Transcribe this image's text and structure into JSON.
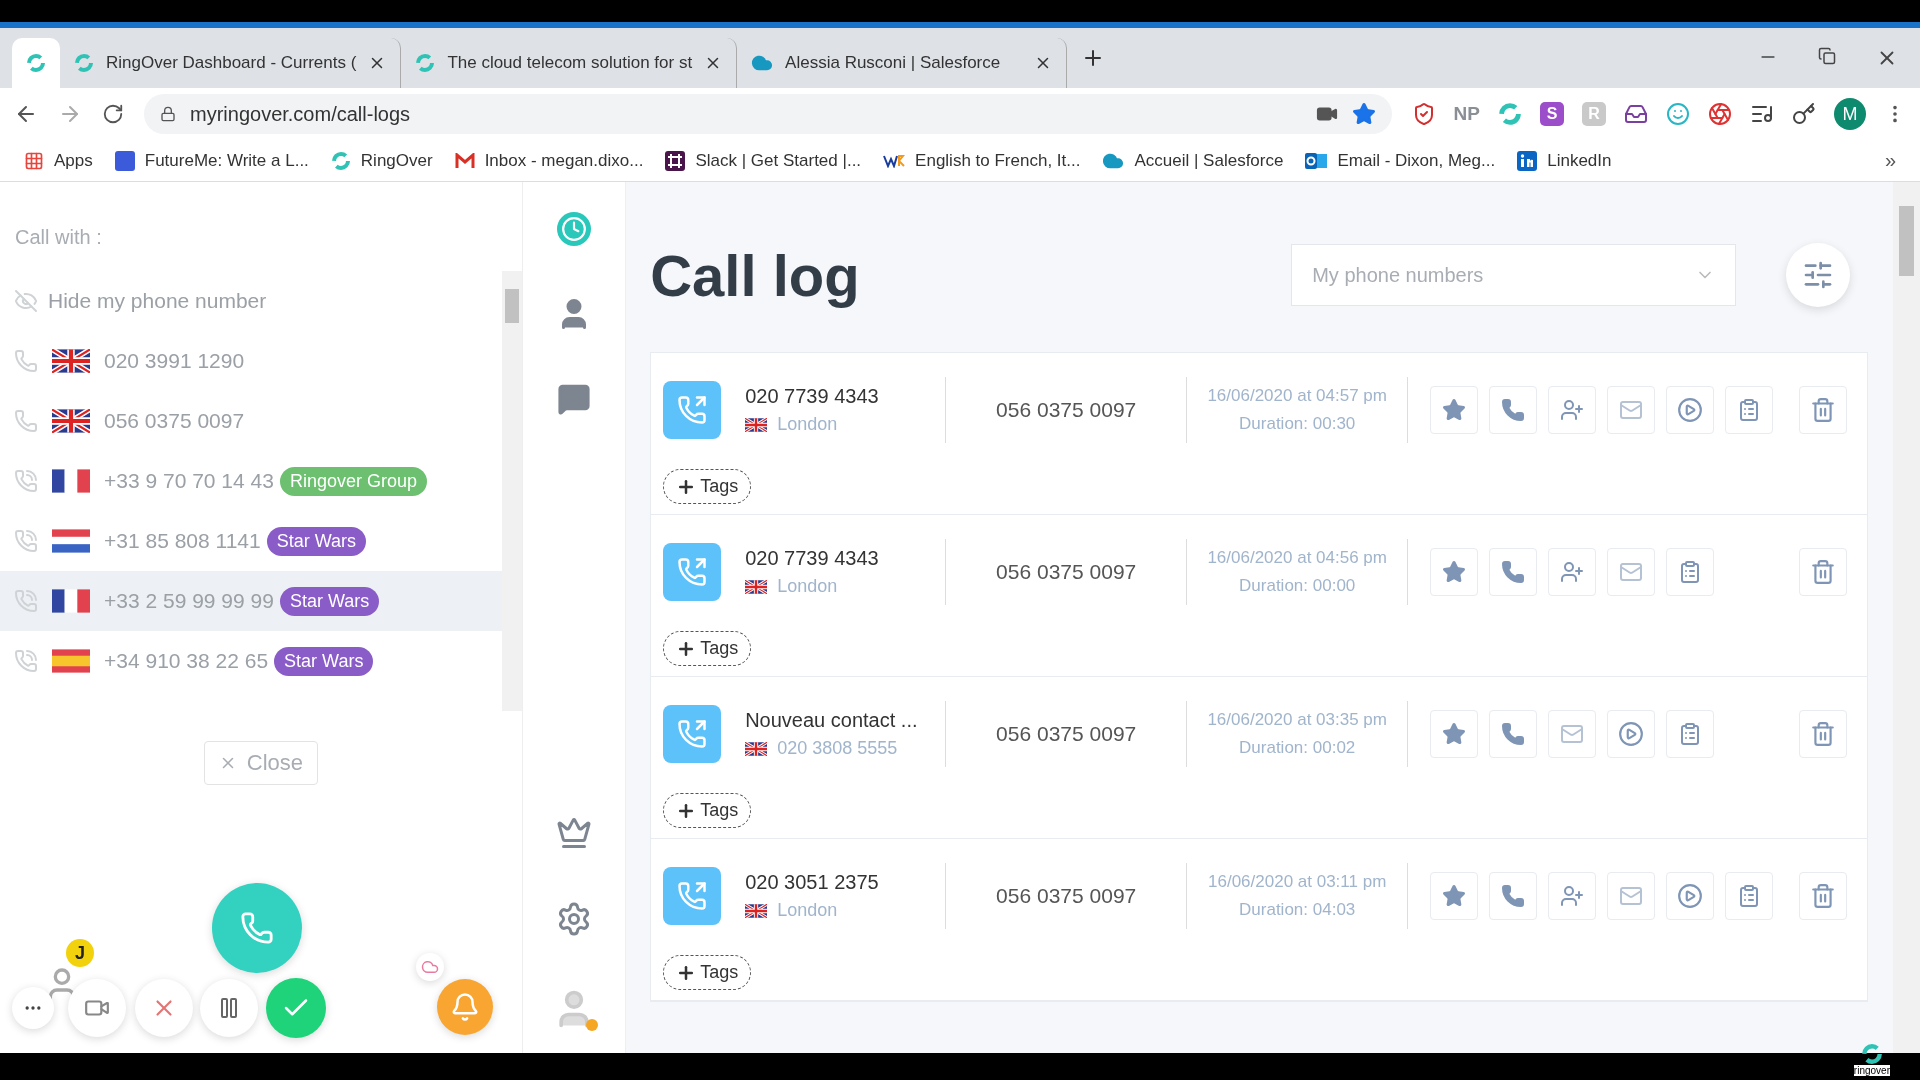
{
  "browser": {
    "tabs": [
      {
        "kind": "ringover",
        "selected": true
      },
      {
        "kind": "ringover",
        "title": "RingOver Dashboard - Currents (",
        "selected": false
      },
      {
        "kind": "ringover",
        "title": "The cloud telecom solution for st",
        "selected": false
      },
      {
        "kind": "salesforce",
        "title": "Alessia Rusconi | Salesforce",
        "selected": false
      }
    ],
    "url": "myringover.com/call-logs",
    "extensions": [
      {
        "kind": "shield"
      },
      {
        "kind": "text",
        "label": "NP"
      },
      {
        "kind": "ringover"
      },
      {
        "kind": "letter",
        "label": "S",
        "color": "#9b4dca"
      },
      {
        "kind": "letter",
        "label": "R",
        "color": "#c9c9c9"
      },
      {
        "kind": "inbox"
      },
      {
        "kind": "face"
      },
      {
        "kind": "swirl"
      },
      {
        "kind": "playlist"
      },
      {
        "kind": "key"
      }
    ],
    "profile": "M",
    "bookmarks": [
      {
        "kind": "apps",
        "label": "Apps"
      },
      {
        "kind": "square",
        "label": "FutureMe: Write a L..."
      },
      {
        "kind": "ringover",
        "label": "RingOver"
      },
      {
        "kind": "mail",
        "label": "Inbox - megan.dixo..."
      },
      {
        "kind": "slack",
        "label": "Slack | Get Started |..."
      },
      {
        "kind": "wr",
        "label": "English to French, It..."
      },
      {
        "kind": "cloud",
        "label": "Accueil | Salesforce"
      },
      {
        "kind": "outlook",
        "label": "Email - Dixon, Meg..."
      },
      {
        "kind": "linkedin",
        "label": "LinkedIn"
      }
    ],
    "bookmarks_more": "»"
  },
  "call_panel": {
    "heading": "Call with :",
    "options": [
      {
        "kind": "hide",
        "label": "Hide my phone number",
        "highlighted": false
      },
      {
        "kind": "phone",
        "flag": {
          "kind": "gb"
        },
        "label": "020 3991 1290",
        "highlighted": false
      },
      {
        "kind": "phone",
        "flag": {
          "kind": "gb"
        },
        "label": "056 0375 0097",
        "highlighted": false
      },
      {
        "kind": "voip",
        "flag": {
          "kind": "fr"
        },
        "label": "+33 9 70 70 14 43",
        "highlighted": false,
        "tag": {
          "label": "Ringover Group",
          "color": "#6cc070"
        }
      },
      {
        "kind": "voip",
        "flag": {
          "kind": "nl"
        },
        "label": "+31 85 808 1141",
        "highlighted": false,
        "tag": {
          "label": "Star Wars",
          "color": "#8a5cc8"
        }
      },
      {
        "kind": "voip",
        "flag": {
          "kind": "fr"
        },
        "label": "+33 2 59 99 99 99",
        "highlighted": true,
        "tag": {
          "label": "Star Wars",
          "color": "#8a5cc8"
        }
      },
      {
        "kind": "voip",
        "flag": {
          "kind": "es"
        },
        "label": "+34 910 38 22 65",
        "highlighted": false,
        "tag": {
          "label": "Star Wars",
          "color": "#8a5cc8"
        }
      }
    ],
    "close": "Close"
  },
  "call_controls": {
    "badge": "J"
  },
  "nav": [
    {
      "kind": "history",
      "selected": true
    },
    {
      "kind": "contacts",
      "selected": false
    },
    {
      "kind": "chat",
      "selected": false
    },
    {
      "kind": "crown",
      "selected": false
    },
    {
      "kind": "settings",
      "selected": false
    },
    {
      "kind": "avatar",
      "selected": false
    }
  ],
  "call_log": {
    "title": "Call log",
    "phone_filter": {
      "placeholder": "My phone numbers"
    },
    "rows": [
      {
        "name": "020 7739 4343",
        "flag": {
          "kind": "gb"
        },
        "detail": "London",
        "line": "056 0375 0097",
        "date": "16/06/2020 at 04:57 pm",
        "duration": "Duration: 00:30",
        "actions": [
          {
            "kind": "star"
          },
          {
            "kind": "call"
          },
          {
            "kind": "add_contact"
          },
          {
            "kind": "message"
          },
          {
            "kind": "play"
          },
          {
            "kind": "notes"
          }
        ],
        "tags_label": "Tags"
      },
      {
        "name": "020 7739 4343",
        "flag": {
          "kind": "gb"
        },
        "detail": "London",
        "line": "056 0375 0097",
        "date": "16/06/2020 at 04:56 pm",
        "duration": "Duration: 00:00",
        "actions": [
          {
            "kind": "star"
          },
          {
            "kind": "call"
          },
          {
            "kind": "add_contact"
          },
          {
            "kind": "message"
          },
          {
            "kind": "notes"
          }
        ],
        "tags_label": "Tags"
      },
      {
        "name": "Nouveau contact ...",
        "flag": {
          "kind": "gb"
        },
        "detail": "020 3808 5555",
        "line": "056 0375 0097",
        "date": "16/06/2020 at 03:35 pm",
        "duration": "Duration: 00:02",
        "actions": [
          {
            "kind": "star"
          },
          {
            "kind": "call"
          },
          {
            "kind": "message"
          },
          {
            "kind": "play"
          },
          {
            "kind": "notes"
          }
        ],
        "tags_label": "Tags"
      },
      {
        "name": "020 3051 2375",
        "flag": {
          "kind": "gb"
        },
        "detail": "London",
        "line": "056 0375 0097",
        "date": "16/06/2020 at 03:11 pm",
        "duration": "Duration: 04:03",
        "actions": [
          {
            "kind": "star"
          },
          {
            "kind": "call"
          },
          {
            "kind": "add_contact"
          },
          {
            "kind": "message"
          },
          {
            "kind": "play"
          },
          {
            "kind": "notes"
          }
        ],
        "tags_label": "Tags"
      }
    ]
  },
  "brand": "ringover"
}
